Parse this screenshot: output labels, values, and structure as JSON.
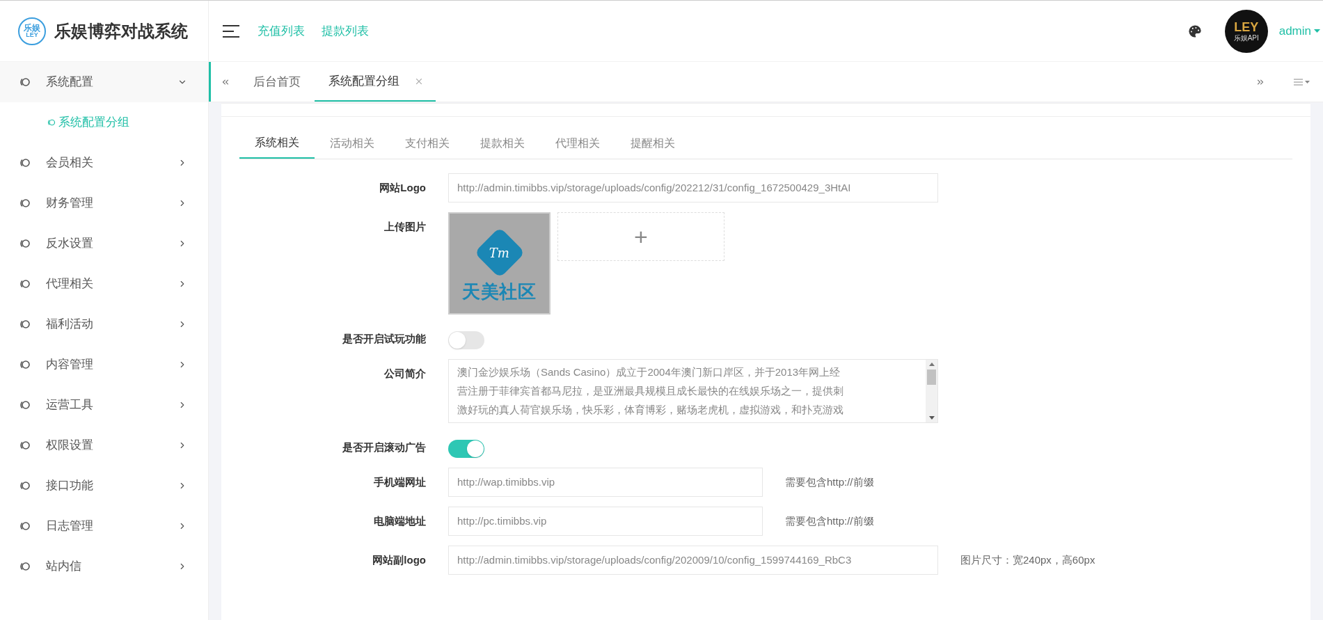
{
  "brand": {
    "logo_top": "乐娱",
    "logo_bottom": "LEY",
    "title": "乐娱博弈对战系统"
  },
  "top_links": [
    "充值列表",
    "提款列表"
  ],
  "user": {
    "avatar_text": "LEY",
    "avatar_subtext": "乐娱API",
    "name": "admin"
  },
  "sidebar": {
    "items": [
      {
        "label": "系统配置",
        "expanded": true,
        "children": [
          {
            "label": "系统配置分组",
            "selected": true
          }
        ]
      },
      {
        "label": "会员相关",
        "expanded": false
      },
      {
        "label": "财务管理",
        "expanded": false
      },
      {
        "label": "反水设置",
        "expanded": false
      },
      {
        "label": "代理相关",
        "expanded": false
      },
      {
        "label": "福利活动",
        "expanded": false
      },
      {
        "label": "内容管理",
        "expanded": false
      },
      {
        "label": "运营工具",
        "expanded": false
      },
      {
        "label": "权限设置",
        "expanded": false
      },
      {
        "label": "接口功能",
        "expanded": false
      },
      {
        "label": "日志管理",
        "expanded": false
      },
      {
        "label": "站内信",
        "expanded": false
      }
    ]
  },
  "page_tabs": [
    {
      "label": "后台首页",
      "selected": false,
      "closable": false
    },
    {
      "label": "系统配置分组",
      "selected": true,
      "closable": true
    }
  ],
  "section_tabs": [
    {
      "label": "系统相关",
      "selected": true
    },
    {
      "label": "活动相关",
      "selected": false
    },
    {
      "label": "支付相关",
      "selected": false
    },
    {
      "label": "提款相关",
      "selected": false
    },
    {
      "label": "代理相关",
      "selected": false
    },
    {
      "label": "提醒相关",
      "selected": false
    }
  ],
  "form": {
    "rows": [
      {
        "kind": "text",
        "label": "网站Logo",
        "value": "http://admin.timibbs.vip/storage/uploads/config/202212/31/config_1672500429_3HtAI",
        "wide": true
      },
      {
        "kind": "upload",
        "label": "上传图片",
        "image_mark": "Tm",
        "image_text": "天美社区",
        "add": "+"
      },
      {
        "kind": "switch",
        "label": "是否开启试玩功能",
        "on": false
      },
      {
        "kind": "textarea",
        "label": "公司简介",
        "lines": [
          "澳门金沙娱乐场（Sands Casino）成立于2004年澳门新口岸区，并于2013年网上经",
          "营注册于菲律宾首都马尼拉，是亚洲最具规模且成长最快的在线娱乐场之一，提供刺",
          "激好玩的真人荷官娱乐场，快乐彩，体育博彩，赌场老虎机，虚拟游戏，和扑克游戏"
        ]
      },
      {
        "kind": "switch",
        "label": "是否开启滚动广告",
        "on": true
      },
      {
        "kind": "text",
        "label": "手机端网址",
        "value": "http://wap.timibbs.vip",
        "hint": "需要包含http://前缀",
        "wide": false
      },
      {
        "kind": "text",
        "label": "电脑端地址",
        "value": "http://pc.timibbs.vip",
        "hint": "需要包含http://前缀",
        "wide": false
      },
      {
        "kind": "text",
        "label": "网站副logo",
        "value": "http://admin.timibbs.vip/storage/uploads/config/202009/10/config_1599744169_RbC3",
        "hint": "图片尺寸：宽240px，高60px",
        "wide": true
      }
    ]
  }
}
